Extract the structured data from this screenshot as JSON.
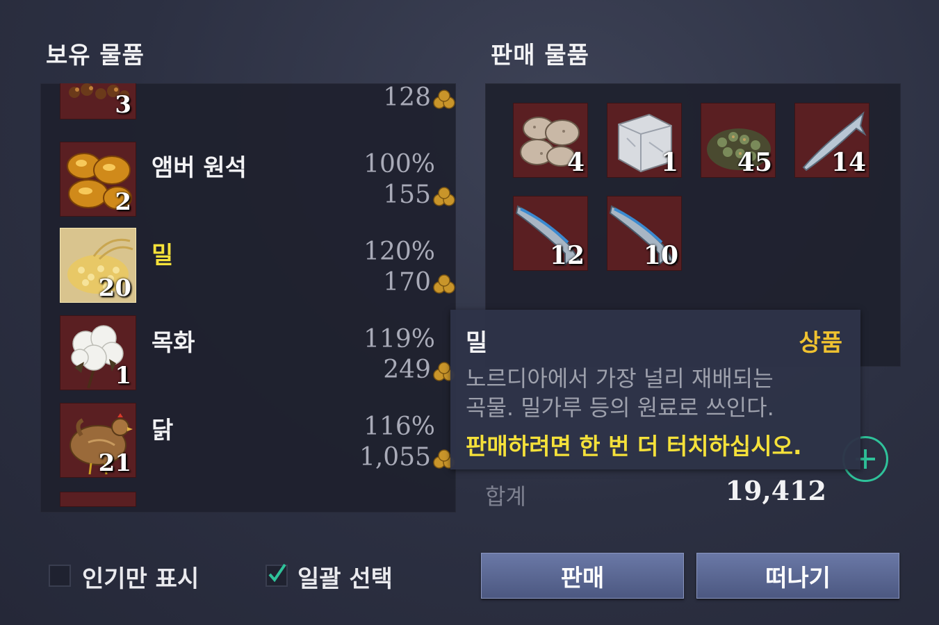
{
  "owned": {
    "title": "보유 물품",
    "items": [
      {
        "name": "",
        "count": "3",
        "percent": "",
        "price": "128",
        "icon": "ore-cluster-icon"
      },
      {
        "name": "앰버 원석",
        "count": "2",
        "percent": "100%",
        "price": "155",
        "icon": "amber-icon"
      },
      {
        "name": "밀",
        "count": "20",
        "percent": "120%",
        "price": "170",
        "icon": "wheat-icon",
        "selected": true
      },
      {
        "name": "목화",
        "count": "1",
        "percent": "119%",
        "price": "249",
        "icon": "cotton-icon"
      },
      {
        "name": "닭",
        "count": "21",
        "percent": "116%",
        "price": "1,055",
        "icon": "chicken-icon"
      }
    ]
  },
  "sale": {
    "title": "판매 물품",
    "items": [
      {
        "count": "4",
        "icon": "stone-icon"
      },
      {
        "count": "1",
        "icon": "marble-block-icon"
      },
      {
        "count": "45",
        "icon": "ore-pile-icon"
      },
      {
        "count": "14",
        "icon": "fish-icon"
      },
      {
        "count": "12",
        "icon": "fish-icon"
      },
      {
        "count": "10",
        "icon": "fish-icon"
      }
    ]
  },
  "tooltip": {
    "name": "밀",
    "grade": "상품",
    "desc_line1": "노르디아에서 가장 널리 재배되는",
    "desc_line2": "곡물. 밀가루 등의 원료로 쓰인다.",
    "hint": "판매하려면 한 번 더 터치하십시오."
  },
  "total": {
    "label": "합계",
    "value": "19,412"
  },
  "controls": {
    "popular_only_label": "인기만 표시",
    "popular_only_checked": false,
    "select_all_label": "일괄 선택",
    "select_all_checked": true,
    "sell_button": "판매",
    "leave_button": "떠나기"
  },
  "colors": {
    "accent_yellow": "#f5e13a",
    "grade_gold": "#f0c230",
    "plus_green": "#2fc29a",
    "slot_red": "#5a1f22"
  }
}
